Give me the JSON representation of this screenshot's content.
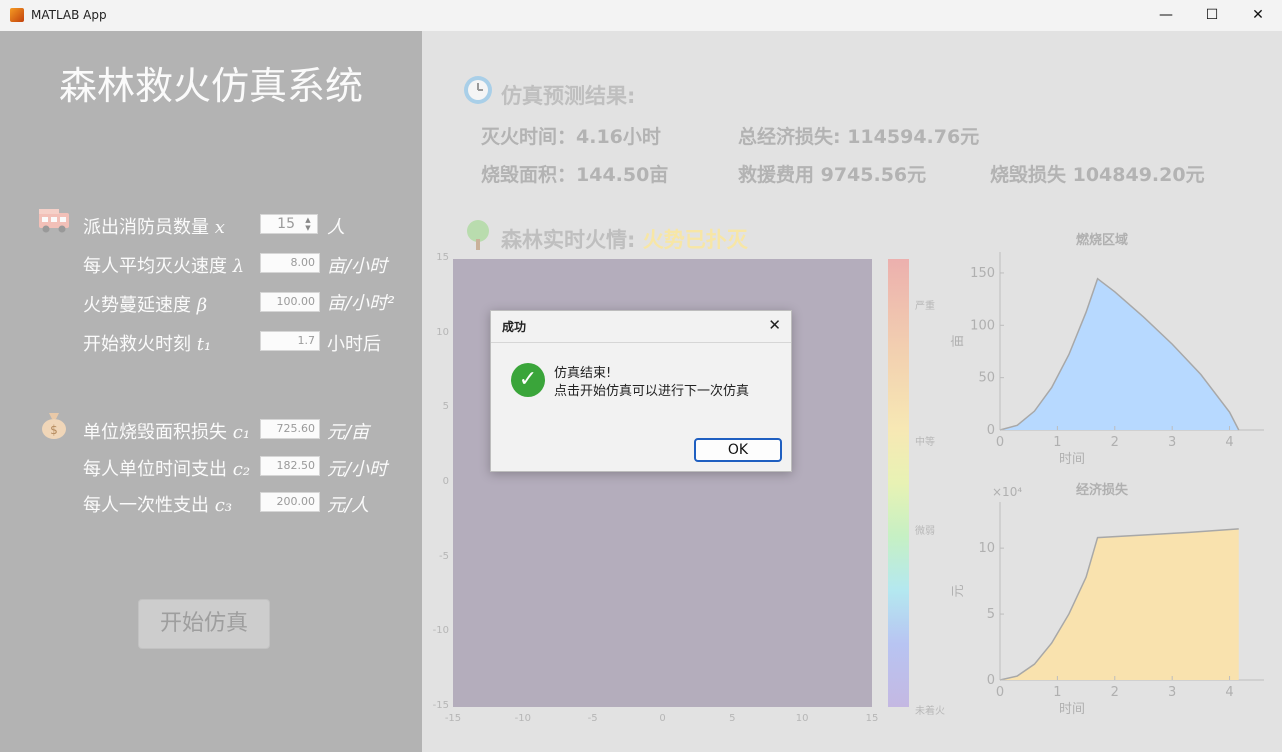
{
  "window": {
    "title": "MATLAB App",
    "minimize_glyph": "—",
    "maximize_glyph": "☐",
    "close_glyph": "✕"
  },
  "app": {
    "heading": "森林救火仿真系统"
  },
  "params": [
    {
      "label": "派出消防员数量",
      "symbol": "x",
      "value": "15",
      "unit": "人"
    },
    {
      "label": "每人平均灭火速度",
      "symbol": "λ",
      "value": "8.00",
      "unit": "亩/小时"
    },
    {
      "label": "火势蔓延速度",
      "symbol": "β",
      "value": "100.00",
      "unit": "亩/小时²"
    },
    {
      "label": "开始救火时刻",
      "symbol": "t₁",
      "value": "1.7",
      "unit": "小时后"
    },
    {
      "label": "单位烧毁面积损失",
      "symbol": "c₁",
      "value": "725.60",
      "unit": "元/亩"
    },
    {
      "label": "每人单位时间支出",
      "symbol": "c₂",
      "value": "182.50",
      "unit": "元/小时"
    },
    {
      "label": "每人一次性支出",
      "symbol": "c₃",
      "value": "200.00",
      "unit": "元/人"
    }
  ],
  "start_button": {
    "label": "开始仿真"
  },
  "results": {
    "title": "仿真预测结果:",
    "extinguish_time": "灭火时间：4.16小时",
    "total_loss": "总经济损失: 114594.76元",
    "burned_area": "烧毁面积：144.50亩",
    "rescue_cost": "救援费用  9745.56元",
    "burn_loss": "烧毁损失  104849.20元"
  },
  "fire_status": {
    "title": "森林实时火情:",
    "value": "火势已扑灭"
  },
  "heatmap": {
    "y_ticks": [
      "15",
      "10",
      "5",
      "0",
      "-5",
      "-10",
      "-15"
    ],
    "x_ticks": [
      "-15",
      "-10",
      "-5",
      "0",
      "5",
      "10",
      "15"
    ],
    "colorbar_labels": [
      "严重",
      "中等",
      "微弱",
      "未着火"
    ],
    "colors": {
      "plot": "#b4adbc"
    }
  },
  "chart_data": [
    {
      "type": "area",
      "title": "燃烧区域",
      "xlabel": "时间",
      "ylabel": "亩",
      "x_ticks": [
        "0",
        "1",
        "2",
        "3",
        "4"
      ],
      "y_ticks": [
        "0",
        "50",
        "100",
        "150"
      ],
      "xlim": [
        0,
        4.6
      ],
      "ylim": [
        0,
        170
      ],
      "x": [
        0,
        0.3,
        0.6,
        0.9,
        1.2,
        1.5,
        1.7,
        2.0,
        2.5,
        3.0,
        3.5,
        4.0,
        4.16
      ],
      "y": [
        0,
        4.5,
        18,
        40.5,
        72,
        112.5,
        144.5,
        132,
        108,
        82,
        53,
        17,
        0
      ],
      "colors": {
        "fill": "#b7d9ff",
        "line": "#a8a8a8"
      }
    },
    {
      "type": "area",
      "title": "经济损失",
      "xlabel": "时间",
      "ylabel": "元",
      "multiplier": "×10⁴",
      "x_ticks": [
        "0",
        "1",
        "2",
        "3",
        "4"
      ],
      "y_ticks": [
        "0",
        "5",
        "10"
      ],
      "xlim": [
        0,
        4.6
      ],
      "ylim": [
        0,
        13.5
      ],
      "x": [
        0,
        0.3,
        0.6,
        0.9,
        1.2,
        1.5,
        1.7,
        2.5,
        3.3,
        4.16
      ],
      "y": [
        0,
        0.3,
        1.2,
        2.8,
        5.0,
        7.8,
        10.8,
        11.0,
        11.2,
        11.46
      ],
      "colors": {
        "fill": "#f9e2ae",
        "line": "#a8a8a8"
      }
    }
  ],
  "dialog": {
    "title": "成功",
    "close_glyph": "✕",
    "line1": "仿真结束!",
    "line2": "点击开始仿真可以进行下一次仿真",
    "ok_label": "OK",
    "check_glyph": "✓"
  }
}
